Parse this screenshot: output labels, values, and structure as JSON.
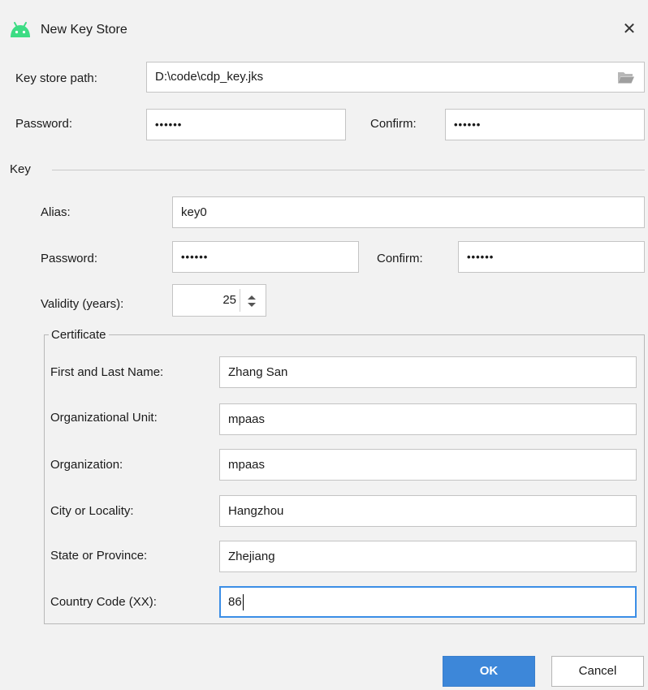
{
  "window": {
    "title": "New Key Store",
    "close_symbol": "✕",
    "title_icon": "android-icon",
    "accent_color": "#3DDC84"
  },
  "keystore": {
    "path_label": "Key store path:",
    "path_value": "D:\\code\\cdp_key.jks",
    "browse_icon": "folder-icon",
    "password_label": "Password:",
    "password_value": "••••••",
    "confirm_label": "Confirm:",
    "confirm_value": "••••••"
  },
  "key": {
    "section_title": "Key",
    "alias_label": "Alias:",
    "alias_value": "key0",
    "password_label": "Password:",
    "password_value": "••••••",
    "confirm_label": "Confirm:",
    "confirm_value": "••••••",
    "validity_label": "Validity (years):",
    "validity_value": "25"
  },
  "certificate": {
    "group_title": "Certificate",
    "fields": [
      {
        "label": "First and Last Name:",
        "value": "Zhang San"
      },
      {
        "label": "Organizational Unit:",
        "value": "mpaas"
      },
      {
        "label": "Organization:",
        "value": "mpaas"
      },
      {
        "label": "City or Locality:",
        "value": "Hangzhou"
      },
      {
        "label": "State or Province:",
        "value": "Zhejiang"
      },
      {
        "label": "Country Code (XX):",
        "value": "86"
      }
    ]
  },
  "buttons": {
    "ok_label": "OK",
    "cancel_label": "Cancel",
    "primary_color": "#3D87D9"
  }
}
